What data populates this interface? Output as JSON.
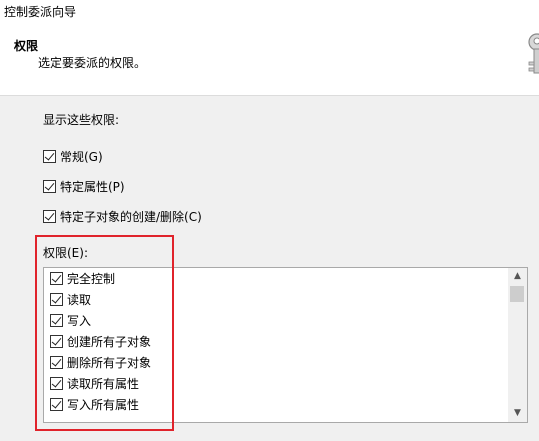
{
  "window": {
    "title": "控制委派向导"
  },
  "header": {
    "title": "权限",
    "subtitle": "选定要委派的权限。"
  },
  "show_section": {
    "label": "显示这些权限:",
    "options": [
      {
        "label": "常规(G)",
        "checked": true
      },
      {
        "label": "特定属性(P)",
        "checked": true
      },
      {
        "label": "特定子对象的创建/删除(C)",
        "checked": true
      }
    ]
  },
  "permissions": {
    "label": "权限(E):",
    "items": [
      {
        "label": "完全控制",
        "checked": true
      },
      {
        "label": "读取",
        "checked": true
      },
      {
        "label": "写入",
        "checked": true
      },
      {
        "label": "创建所有子对象",
        "checked": true
      },
      {
        "label": "删除所有子对象",
        "checked": true
      },
      {
        "label": "读取所有属性",
        "checked": true
      },
      {
        "label": "写入所有属性",
        "checked": true
      }
    ]
  },
  "highlight_color": "#e0232b",
  "icons": {
    "header": "keys-icon",
    "scroll_up": "chevron-up-icon",
    "scroll_down": "chevron-down-icon"
  }
}
